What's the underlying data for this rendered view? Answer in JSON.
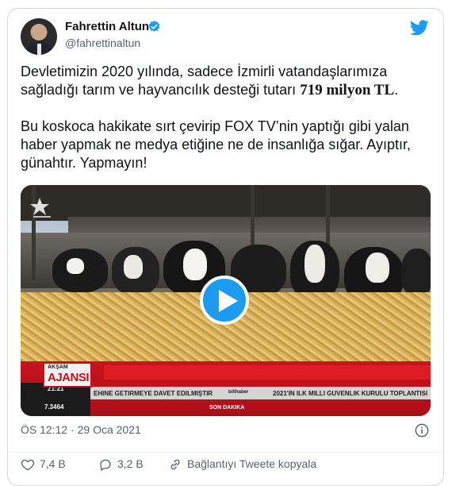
{
  "author": {
    "name": "Fahrettin Altun",
    "handle": "@fahrettinaltun"
  },
  "tweet": {
    "paragraph1_before": "Devletimizin 2020 yılında, sadece İzmirli vatandaşlarımıza sağladığı tarım ve hayvancılık desteği tutarı ",
    "amount": "719 milyon TL",
    "paragraph1_after": ".",
    "paragraph2": "Bu koskoca hakikate sırt çevirip FOX TV’nin yaptığı gibi yalan haber yapmak ne medya etiğine ne de insanlığa sığar. Ayıptır, günahtır. Yapmayın!"
  },
  "video": {
    "channel_small": "AKŞAM",
    "channel_big": "AJANSI",
    "ticker_left": "EHINE GETIRMEYE DAVET EDILMIŞTIR",
    "ticker_right": "2021'IN ILK MILLI GUVENLIK KURULU TOPLANTISI",
    "time": "21:21",
    "stock": "7.3464",
    "breaking": "SON DAKIKA",
    "mini_label": "bilthaber"
  },
  "meta": {
    "time": "ÖS 12:12",
    "separator": "·",
    "date": "29 Oca 2021"
  },
  "actions": {
    "likes": "7,4 B",
    "replies": "3,2 B",
    "copy_link": "Bağlantıyı Tweete kopyala"
  },
  "colors": {
    "twitter_blue": "#1d9bf0",
    "text_secondary": "#536471",
    "ticker_red": "#c9141d"
  }
}
